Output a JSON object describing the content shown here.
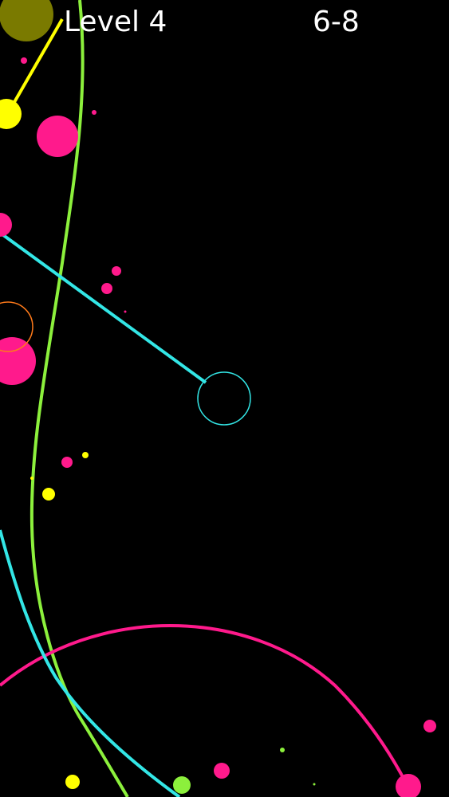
{
  "hud": {
    "level": "Level 4",
    "score": "6-8"
  },
  "colors": {
    "background": "#000000",
    "pink": "#ff1a8c",
    "yellow": "#ffff00",
    "cyan": "#33e6e6",
    "green": "#8cf03c",
    "olive": "#7a7a00",
    "orange": "#ff7a1a",
    "text": "#ffffff"
  },
  "scene": {
    "curves": [
      {
        "name": "green-curve",
        "color": "green"
      },
      {
        "name": "pink-arc-curve",
        "color": "pink"
      },
      {
        "name": "cyan-lower-curve",
        "color": "cyan"
      }
    ],
    "tethers": [
      {
        "name": "yellow-tether-line",
        "color": "yellow"
      },
      {
        "name": "cyan-tether-line",
        "color": "cyan"
      }
    ],
    "orbs": [
      {
        "name": "olive-orb",
        "color": "olive",
        "kind": "filled"
      },
      {
        "name": "yellow-anchor-orb",
        "color": "yellow",
        "kind": "filled"
      },
      {
        "name": "pink-orb-large",
        "color": "pink",
        "kind": "filled"
      },
      {
        "name": "pink-orb-left-upper",
        "color": "pink",
        "kind": "filled"
      },
      {
        "name": "pink-orb-left-lower",
        "color": "pink",
        "kind": "filled"
      },
      {
        "name": "orange-ring-orb",
        "color": "orange",
        "kind": "ring"
      },
      {
        "name": "cyan-target-ring",
        "color": "cyan",
        "kind": "ring"
      },
      {
        "name": "pink-dot",
        "color": "pink",
        "kind": "filled"
      },
      {
        "name": "yellow-dot",
        "color": "yellow",
        "kind": "filled"
      },
      {
        "name": "green-dot",
        "color": "green",
        "kind": "filled"
      }
    ]
  }
}
